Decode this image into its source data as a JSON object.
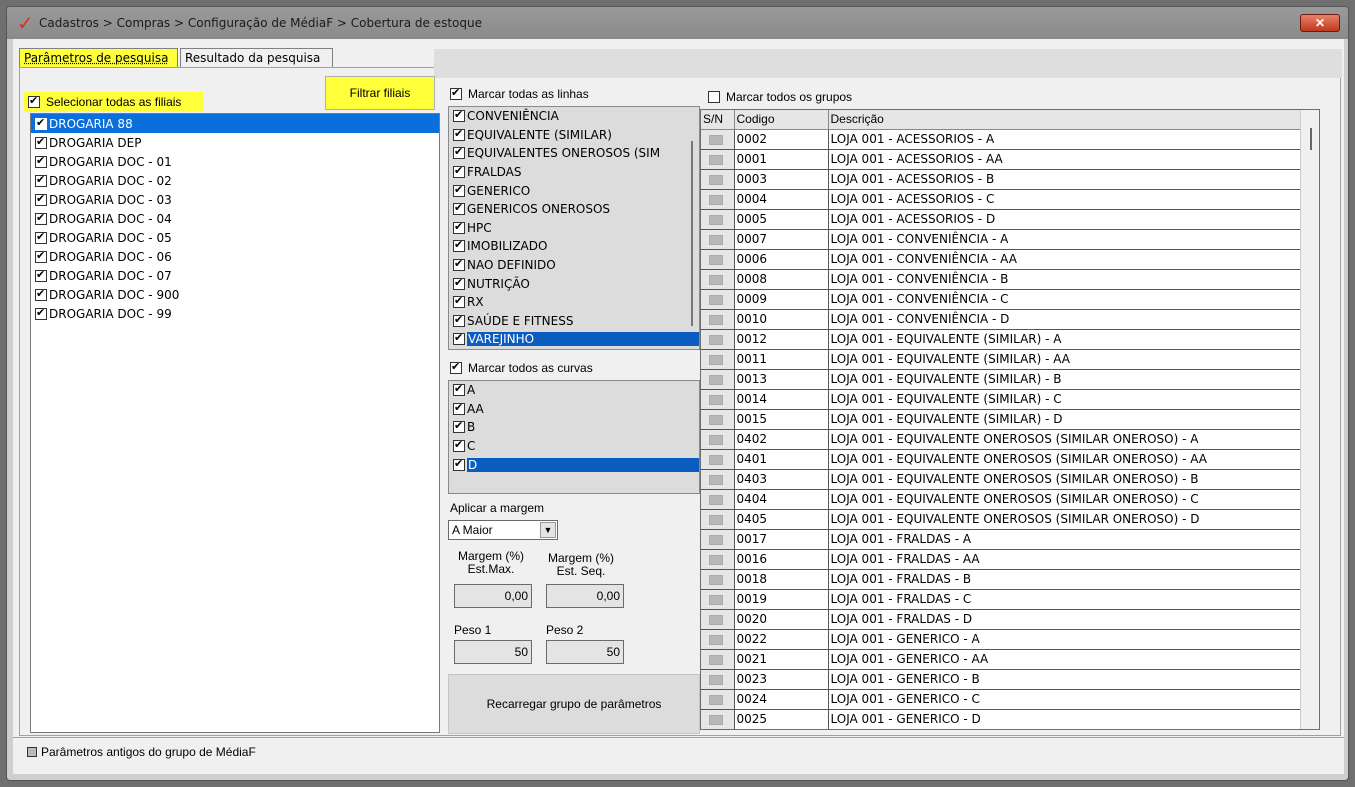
{
  "window": {
    "title": "Cadastros > Compras > Configuração de MédiaF > Cobertura de estoque",
    "close_label": "✕"
  },
  "tabs": [
    {
      "label": "Parâmetros de pesquisa",
      "active": true
    },
    {
      "label": "Resultado da pesquisa",
      "active": false
    }
  ],
  "filiais": {
    "select_all_label": "Selecionar todas as filiais",
    "filter_button": "Filtrar filiais",
    "items": [
      {
        "label": "DROGARIA 88",
        "checked": true,
        "selected": true
      },
      {
        "label": "DROGARIA DEP",
        "checked": true
      },
      {
        "label": "DROGARIA DOC - 01",
        "checked": true
      },
      {
        "label": "DROGARIA DOC - 02",
        "checked": true
      },
      {
        "label": "DROGARIA DOC - 03",
        "checked": true
      },
      {
        "label": "DROGARIA DOC - 04",
        "checked": true
      },
      {
        "label": "DROGARIA DOC - 05",
        "checked": true
      },
      {
        "label": "DROGARIA DOC - 06",
        "checked": true
      },
      {
        "label": "DROGARIA DOC - 07",
        "checked": true
      },
      {
        "label": "DROGARIA DOC - 900",
        "checked": true
      },
      {
        "label": "DROGARIA DOC - 99",
        "checked": true
      }
    ]
  },
  "linhas": {
    "select_all_label": "Marcar todas as linhas",
    "items": [
      "CONVENIÊNCIA",
      "EQUIVALENTE (SIMILAR)",
      "EQUIVALENTES ONEROSOS (SIM",
      "FRALDAS",
      "GENERICO",
      "GENERICOS ONEROSOS",
      "HPC",
      "IMOBILIZADO",
      "NAO DEFINIDO",
      "NUTRIÇÃO",
      "RX",
      "SAÚDE E FITNESS",
      "VAREJINHO"
    ]
  },
  "curvas": {
    "select_all_label": "Marcar todos as curvas",
    "items": [
      "A",
      "AA",
      "B",
      "C",
      "D"
    ]
  },
  "margem": {
    "label": "Aplicar a margem",
    "selected": "A Maior",
    "arrow": "▼",
    "est_max_label_1": "Margem (%)",
    "est_max_label_2": "Est.Max.",
    "est_seq_label_1": "Margem (%)",
    "est_seq_label_2": "Est. Seq.",
    "est_max_value": "0,00",
    "est_seq_value": "0,00",
    "peso1_label": "Peso 1",
    "peso2_label": "Peso 2",
    "peso1_value": "50",
    "peso2_value": "50",
    "reload_button": "Recarregar grupo de parâmetros"
  },
  "grupos": {
    "select_all_label": "Marcar todos os grupos",
    "columns": [
      "S/N",
      "Codigo",
      "Descrição"
    ],
    "rows": [
      [
        "0002",
        "LOJA 001 - ACESSORIOS - A"
      ],
      [
        "0001",
        "LOJA 001 - ACESSORIOS - AA"
      ],
      [
        "0003",
        "LOJA 001 - ACESSORIOS - B"
      ],
      [
        "0004",
        "LOJA 001 - ACESSORIOS - C"
      ],
      [
        "0005",
        "LOJA 001 - ACESSORIOS - D"
      ],
      [
        "0007",
        "LOJA 001 - CONVENIÊNCIA - A"
      ],
      [
        "0006",
        "LOJA 001 - CONVENIÊNCIA - AA"
      ],
      [
        "0008",
        "LOJA 001 - CONVENIÊNCIA - B"
      ],
      [
        "0009",
        "LOJA 001 - CONVENIÊNCIA - C"
      ],
      [
        "0010",
        "LOJA 001 - CONVENIÊNCIA - D"
      ],
      [
        "0012",
        "LOJA 001 - EQUIVALENTE (SIMILAR) - A"
      ],
      [
        "0011",
        "LOJA 001 - EQUIVALENTE (SIMILAR) - AA"
      ],
      [
        "0013",
        "LOJA 001 - EQUIVALENTE (SIMILAR) - B"
      ],
      [
        "0014",
        "LOJA 001 - EQUIVALENTE (SIMILAR) - C"
      ],
      [
        "0015",
        "LOJA 001 - EQUIVALENTE (SIMILAR) - D"
      ],
      [
        "0402",
        "LOJA 001 - EQUIVALENTE ONEROSOS (SIMILAR ONEROSO) - A"
      ],
      [
        "0401",
        "LOJA 001 - EQUIVALENTE ONEROSOS (SIMILAR ONEROSO) - AA"
      ],
      [
        "0403",
        "LOJA 001 - EQUIVALENTE ONEROSOS (SIMILAR ONEROSO) - B"
      ],
      [
        "0404",
        "LOJA 001 - EQUIVALENTE ONEROSOS (SIMILAR ONEROSO) - C"
      ],
      [
        "0405",
        "LOJA 001 - EQUIVALENTE ONEROSOS (SIMILAR ONEROSO) - D"
      ],
      [
        "0017",
        "LOJA 001 - FRALDAS - A"
      ],
      [
        "0016",
        "LOJA 001 - FRALDAS - AA"
      ],
      [
        "0018",
        "LOJA 001 - FRALDAS - B"
      ],
      [
        "0019",
        "LOJA 001 - FRALDAS - C"
      ],
      [
        "0020",
        "LOJA 001 - FRALDAS - D"
      ],
      [
        "0022",
        "LOJA 001 - GENERICO - A"
      ],
      [
        "0021",
        "LOJA 001 - GENERICO - AA"
      ],
      [
        "0023",
        "LOJA 001 - GENERICO - B"
      ],
      [
        "0024",
        "LOJA 001 - GENERICO - C"
      ],
      [
        "0025",
        "LOJA 001 - GENERICO - D"
      ]
    ]
  },
  "footer": {
    "old_params_label": "Parâmetros antigos do grupo de MédiaF"
  },
  "colors": {
    "highlight": "#ffff3a",
    "selection": "#0a6fdb"
  }
}
